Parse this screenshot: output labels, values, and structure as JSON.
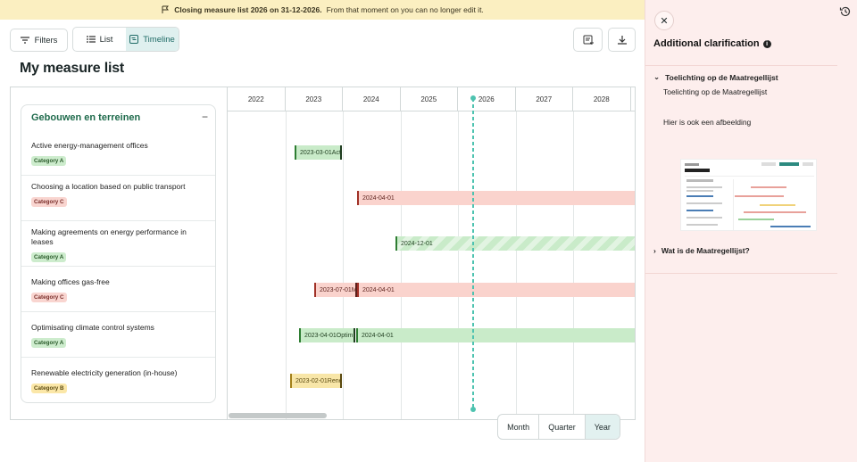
{
  "banner": {
    "bold": "Closing measure list 2026 on 31-12-2026.",
    "text": "From that moment on you can no longer edit it."
  },
  "toolbar": {
    "filters": "Filters",
    "list": "List",
    "timeline": "Timeline"
  },
  "page": {
    "title": "My measure list"
  },
  "group": {
    "title": "Gebouwen en terreinen",
    "collapse": "−"
  },
  "measures": [
    {
      "name": "Active energy-management offices",
      "category": "Category A"
    },
    {
      "name": "Choosing a location based on public transport",
      "category": "Category C"
    },
    {
      "name": "Making agreements on energy performance in leases",
      "category": "Category A"
    },
    {
      "name": "Making offices gas-free",
      "category": "Category C"
    },
    {
      "name": "Optimisating climate control systems",
      "category": "Category A"
    },
    {
      "name": "Renewable electricity generation (in-house)",
      "category": "Category B"
    }
  ],
  "years": [
    "2022",
    "2023",
    "2024",
    "2025",
    "2026",
    "2027",
    "2028"
  ],
  "bars": [
    {
      "label": "2023-03-01Act"
    },
    {
      "label": "2024-04-01"
    },
    {
      "label": "2024-12-01"
    },
    {
      "label": "2023-07-01M"
    },
    {
      "label": "2024-04-01"
    },
    {
      "label": "2023-04-01Optim"
    },
    {
      "label": "2024-04-01"
    },
    {
      "label": "2023-02-01Rene"
    }
  ],
  "zoom": {
    "month": "Month",
    "quarter": "Quarter",
    "year": "Year"
  },
  "panel": {
    "title": "Additional clarification",
    "section1": "Toelichting op de Maatregellijst",
    "text1": "Toelichting op de Maatregellijst",
    "text2": "Hier is ook een afbeelding",
    "section2": "Wat is de Maatregellijst?"
  },
  "colors": {
    "accent": "#1f6b66",
    "banner": "#fbefc1",
    "panel": "#fdeeed",
    "today_line": "#4ec3b0"
  }
}
